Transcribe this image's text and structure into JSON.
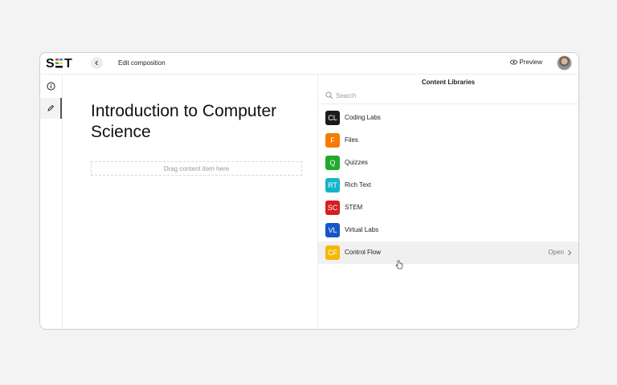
{
  "header": {
    "logo_text": "S T",
    "edit_title": "Edit composition",
    "preview_label": "Preview"
  },
  "document": {
    "title": "Introduction to Computer Science",
    "dropzone_text": "Drag content item here"
  },
  "libraries": {
    "title": "Content Libraries",
    "search_placeholder": "Search",
    "items": [
      {
        "abbr": "CL",
        "label": "Coding Labs",
        "color": "#1b1b1b"
      },
      {
        "abbr": "F",
        "label": "Files",
        "color": "#f57c00"
      },
      {
        "abbr": "Q",
        "label": "Quizzes",
        "color": "#1faa2b"
      },
      {
        "abbr": "RT",
        "label": "Rich Text",
        "color": "#13b5c8"
      },
      {
        "abbr": "SC",
        "label": "STEM",
        "color": "#d61f1f"
      },
      {
        "abbr": "VL",
        "label": "Virtual Labs",
        "color": "#1456c8"
      },
      {
        "abbr": "CF",
        "label": "Control Flow",
        "color": "#f5b800",
        "open_label": "Open"
      }
    ]
  },
  "icons": {
    "info": "info-icon",
    "edit": "pencil-icon",
    "back": "chevron-left-icon",
    "preview": "eye-icon",
    "search": "search-icon",
    "open": "chevron-right-icon"
  }
}
